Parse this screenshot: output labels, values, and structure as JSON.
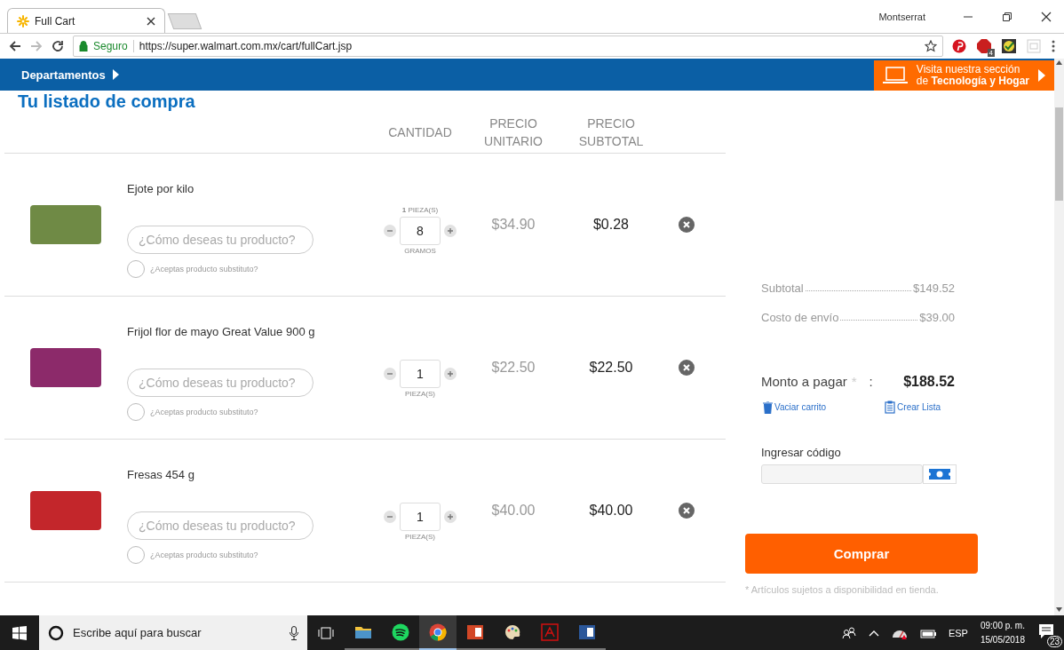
{
  "browser": {
    "tabs": [
      {
        "title": "Full Cart",
        "selected": true
      }
    ],
    "user": "Montserrat",
    "secure_label": "Seguro",
    "url": "https://super.walmart.com.mx/cart/fullCart.jsp",
    "adblock_badge": "4"
  },
  "nav": {
    "departments": "Departamentos",
    "promo_line1": "Visita nuestra sección",
    "promo_line2": "de **Tecnología y Hogar**"
  },
  "cart": {
    "title": "Tu listado de compra",
    "columns": [
      "CANTIDAD",
      "PRECIO UNITARIO",
      "PRECIO SUBTOTAL"
    ],
    "items": [
      {
        "name": "Ejote por kilo",
        "kind": "beans",
        "note_placeholder": "¿Cómo deseas tu producto?",
        "substitute_label": "¿Aceptas producto substituto?",
        "substitute_checked": false,
        "qty_top": "**1** PIEZA(S)",
        "qty": "8",
        "qty_unit": "GRAMOS",
        "unit_price": "$34.90",
        "subtotal": "$0.28"
      },
      {
        "name": "Frijol flor de mayo Great Value 900 g",
        "kind": "bag",
        "note_placeholder": "¿Cómo deseas tu producto?",
        "substitute_label": "¿Aceptas producto substituto?",
        "substitute_checked": false,
        "qty": "1",
        "qty_unit": "PIEZA(S)",
        "unit_price": "$22.50",
        "subtotal": "$22.50"
      },
      {
        "name": "Fresas 454 g",
        "kind": "berries",
        "note_placeholder": "¿Cómo deseas tu producto?",
        "substitute_label": "¿Aceptas producto substituto?",
        "substitute_checked": false,
        "qty": "1",
        "qty_unit": "PIEZA(S)",
        "unit_price": "$40.00",
        "subtotal": "$40.00"
      }
    ]
  },
  "summary": {
    "subtotal_label": "Subtotal",
    "subtotal": "$149.52",
    "shipping_label": "Costo de envío",
    "shipping": "$39.00",
    "total_label": "Monto a pagar",
    "total_mark": "*",
    "total_colon": ":",
    "total": "$188.52",
    "empty_cart": "Vaciar carrito",
    "create_list": "Crear Lista",
    "code_label": "Ingresar código",
    "buy": "Comprar",
    "disclaimer": "* Artículos sujetos a disponibilidad en tienda."
  },
  "taskbar": {
    "search_placeholder": "Escribe aquí para buscar",
    "apps": [
      {
        "kind": "folder",
        "selected": false
      },
      {
        "kind": "spotify",
        "selected": false
      },
      {
        "kind": "chrome",
        "selected": true
      },
      {
        "kind": "powerpoint",
        "selected": false
      },
      {
        "kind": "paint",
        "selected": false
      },
      {
        "kind": "acrobat",
        "selected": false
      },
      {
        "kind": "word",
        "selected": false
      }
    ],
    "language": "ESP",
    "time": "09:00 p. m.",
    "date": "15/05/2018",
    "notifications": "23"
  }
}
